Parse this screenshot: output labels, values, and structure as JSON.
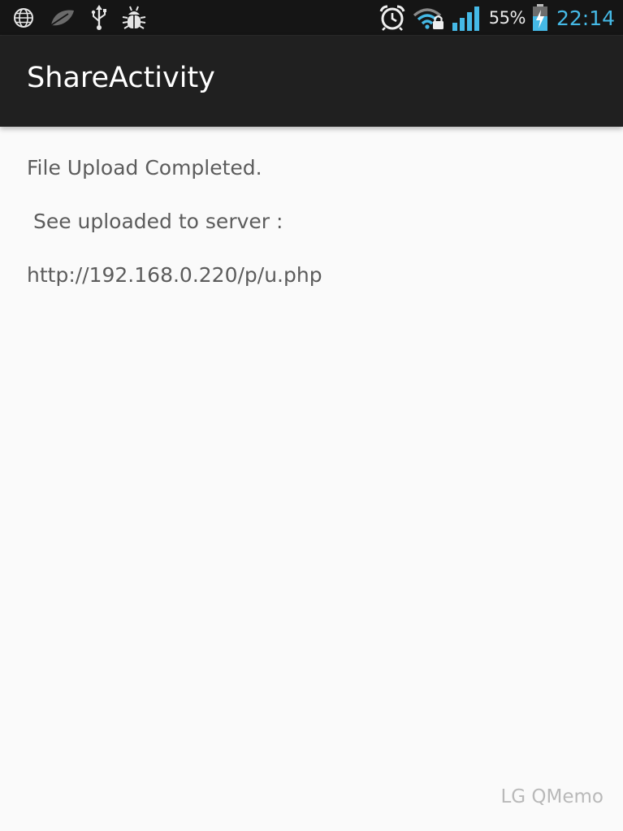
{
  "status_bar": {
    "left_icons": [
      "globe-icon",
      "leaf-icon",
      "usb-icon",
      "debug-bug-icon"
    ],
    "right_icons": [
      "alarm-clock-icon",
      "wifi-lock-icon",
      "signal-bars-icon",
      "battery-charging-icon"
    ],
    "battery_percent": "55%",
    "time": "22:14",
    "colors": {
      "background": "#151515",
      "clock": "#45b9e6",
      "signal": "#45b9e6"
    }
  },
  "action_bar": {
    "title": "ShareActivity",
    "background": "#202020"
  },
  "content": {
    "line1": "File Upload Completed.",
    "line2": " See uploaded to server :",
    "line3": "http://192.168.0.220/p/u.php"
  },
  "watermark": "LG QMemo"
}
